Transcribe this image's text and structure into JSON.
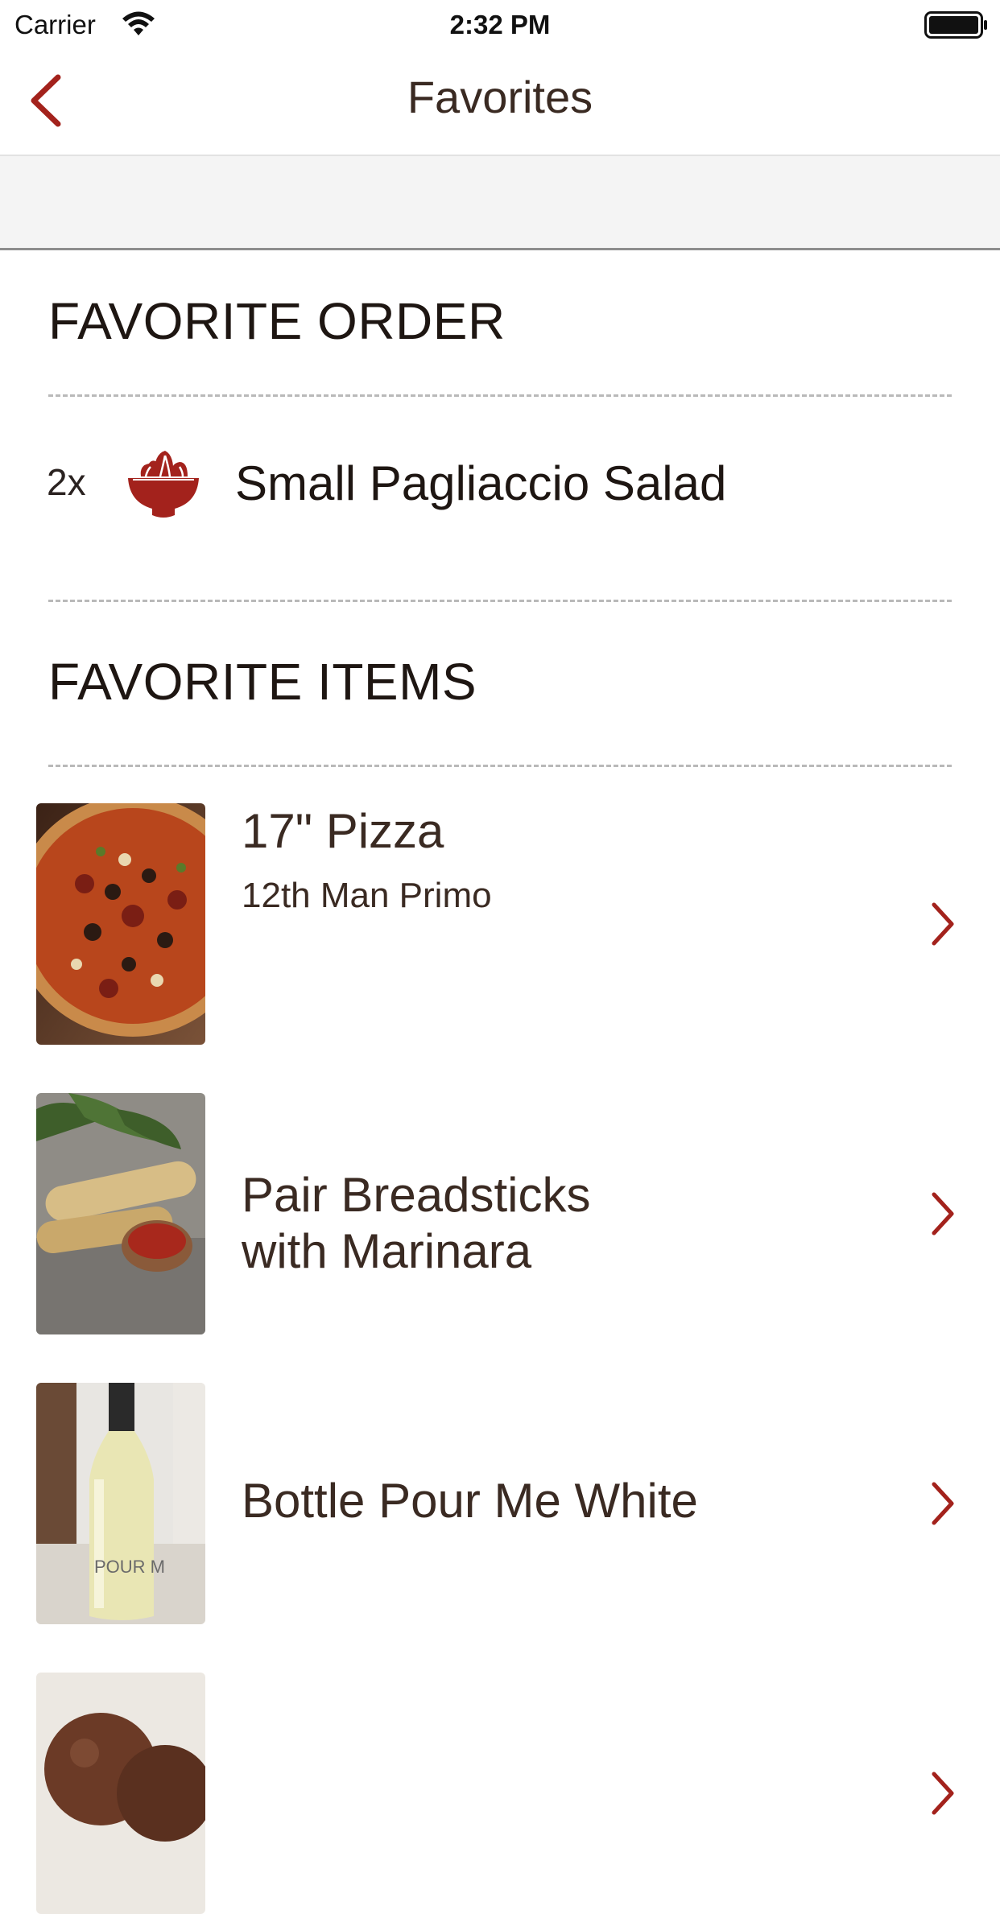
{
  "status_bar": {
    "carrier": "Carrier",
    "time": "2:32 PM"
  },
  "nav": {
    "title": "Favorites"
  },
  "favorite_order": {
    "heading": "FAVORITE ORDER",
    "items": [
      {
        "qty": "2x",
        "icon": "salad-bowl-icon",
        "name": "Small Pagliaccio Salad"
      }
    ]
  },
  "favorite_items": {
    "heading": "FAVORITE ITEMS",
    "items": [
      {
        "title": "17\" Pizza",
        "subtitle": "12th Man Primo",
        "image": "pizza-photo"
      },
      {
        "title": "Pair Breadsticks",
        "title_line2": "with Marinara",
        "image": "breadsticks-photo"
      },
      {
        "title": "Bottle Pour Me White",
        "image": "wine-bottle-photo",
        "label": "POUR M"
      },
      {
        "title": "",
        "image": "chocolate-gelato-photo"
      }
    ]
  },
  "colors": {
    "accent": "#a3221c",
    "text": "#3a2a22",
    "heading": "#1e1612"
  }
}
